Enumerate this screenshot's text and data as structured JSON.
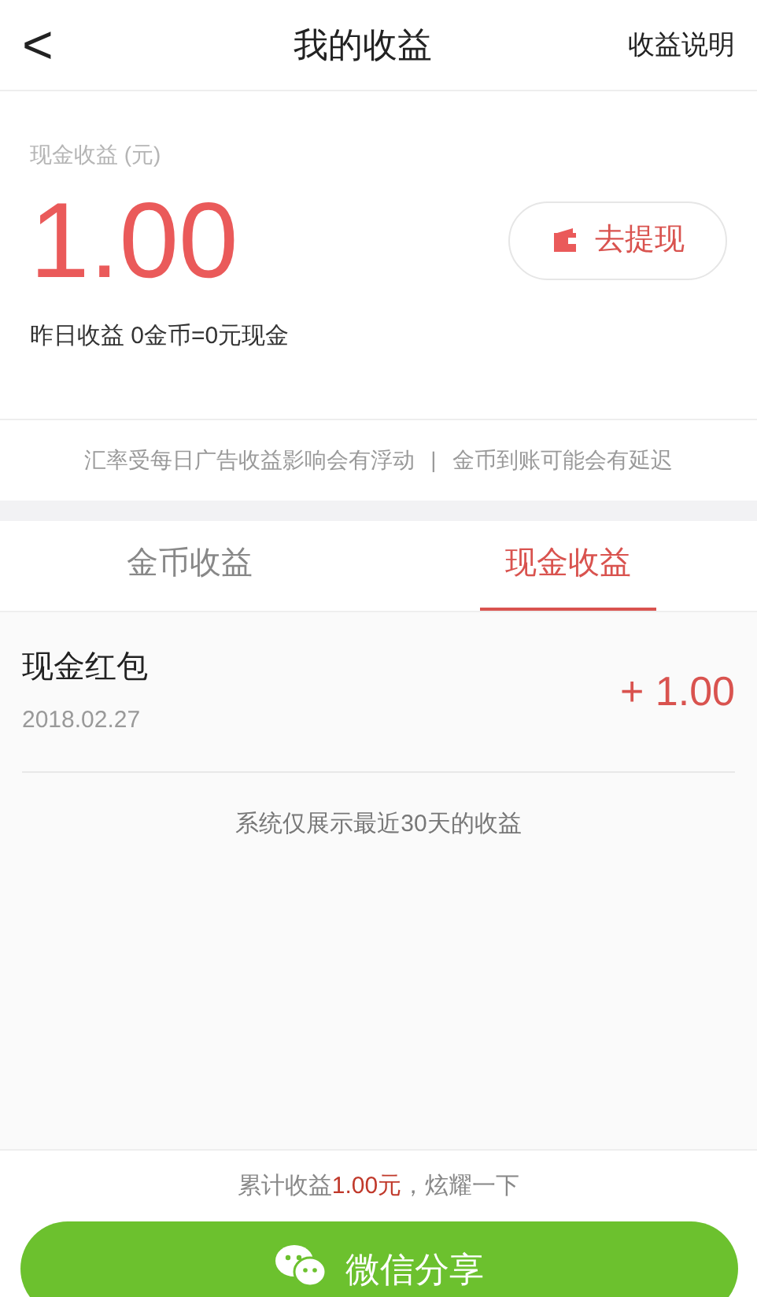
{
  "header": {
    "back": "<",
    "title": "我的收益",
    "action": "收益说明"
  },
  "summary": {
    "label": "现金收益 (元)",
    "amount": "1.00",
    "withdraw_button": "去提现",
    "yesterday": "昨日收益 0金币=0元现金"
  },
  "notice": {
    "left": "汇率受每日广告收益影响会有浮动",
    "separator": "|",
    "right": "金币到账可能会有延迟"
  },
  "tabs": [
    {
      "label": "金币收益",
      "selected": false
    },
    {
      "label": "现金收益",
      "selected": true
    }
  ],
  "records": [
    {
      "title": "现金红包",
      "date": "2018.02.27",
      "amount": "+ 1.00"
    }
  ],
  "list_note": "系统仅展示最近30天的收益",
  "footer": {
    "prefix": "累计收益",
    "total": "1.00元",
    "suffix": "，炫耀一下",
    "share_button": "微信分享"
  }
}
